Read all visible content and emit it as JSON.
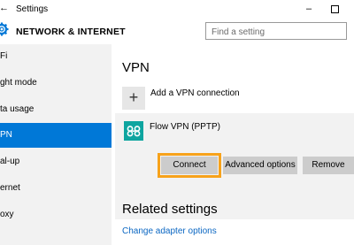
{
  "window": {
    "title": "Settings",
    "back_glyph": "←",
    "minimize_glyph": "–"
  },
  "header": {
    "title": "NETWORK & INTERNET",
    "search_placeholder": "Find a setting"
  },
  "sidebar": {
    "items": [
      {
        "label": "Fi",
        "active": false
      },
      {
        "label": "ght mode",
        "active": false
      },
      {
        "label": "ta usage",
        "active": false
      },
      {
        "label": "PN",
        "active": true
      },
      {
        "label": "al-up",
        "active": false
      },
      {
        "label": "ernet",
        "active": false
      },
      {
        "label": "oxy",
        "active": false
      }
    ]
  },
  "main": {
    "section_title": "VPN",
    "add_vpn": {
      "icon": "+",
      "label": "Add a VPN connection"
    },
    "connection": {
      "name": "Flow VPN (PPTP)",
      "icon": "vpn-link-icon",
      "icon_color": "#0ea5a0",
      "buttons": {
        "connect": "Connect",
        "advanced": "Advanced options",
        "remove": "Remove"
      },
      "highlight_color": "#f7a21b"
    },
    "related_title": "Related settings",
    "related_link": "Change adapter options"
  },
  "colors": {
    "accent": "#0078d7",
    "sidebar_bg": "#f2f2f2",
    "link": "#0a66c2"
  }
}
